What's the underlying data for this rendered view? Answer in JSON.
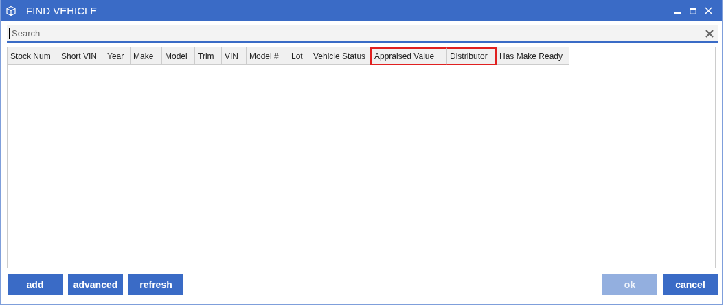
{
  "window": {
    "title": "FIND VEHICLE"
  },
  "search": {
    "placeholder": "Search"
  },
  "table": {
    "columns": [
      {
        "label": "Stock Num",
        "highlighted": false
      },
      {
        "label": "Short VIN",
        "highlighted": false
      },
      {
        "label": "Year",
        "highlighted": false
      },
      {
        "label": "Make",
        "highlighted": false
      },
      {
        "label": "Model",
        "highlighted": false
      },
      {
        "label": "Trim",
        "highlighted": false
      },
      {
        "label": "VIN",
        "highlighted": false
      },
      {
        "label": "Model #",
        "highlighted": false
      },
      {
        "label": "Lot",
        "highlighted": false
      },
      {
        "label": "Vehicle Status",
        "highlighted": false
      },
      {
        "label": "Appraised Value",
        "highlighted": true
      },
      {
        "label": "Distributor",
        "highlighted": true
      },
      {
        "label": "Has Make Ready",
        "highlighted": false
      }
    ]
  },
  "buttons_left": [
    {
      "label": "add",
      "disabled": false
    },
    {
      "label": "advanced",
      "disabled": false
    },
    {
      "label": "refresh",
      "disabled": false
    }
  ],
  "buttons_right": [
    {
      "label": "ok",
      "disabled": true
    },
    {
      "label": "cancel",
      "disabled": false
    }
  ]
}
